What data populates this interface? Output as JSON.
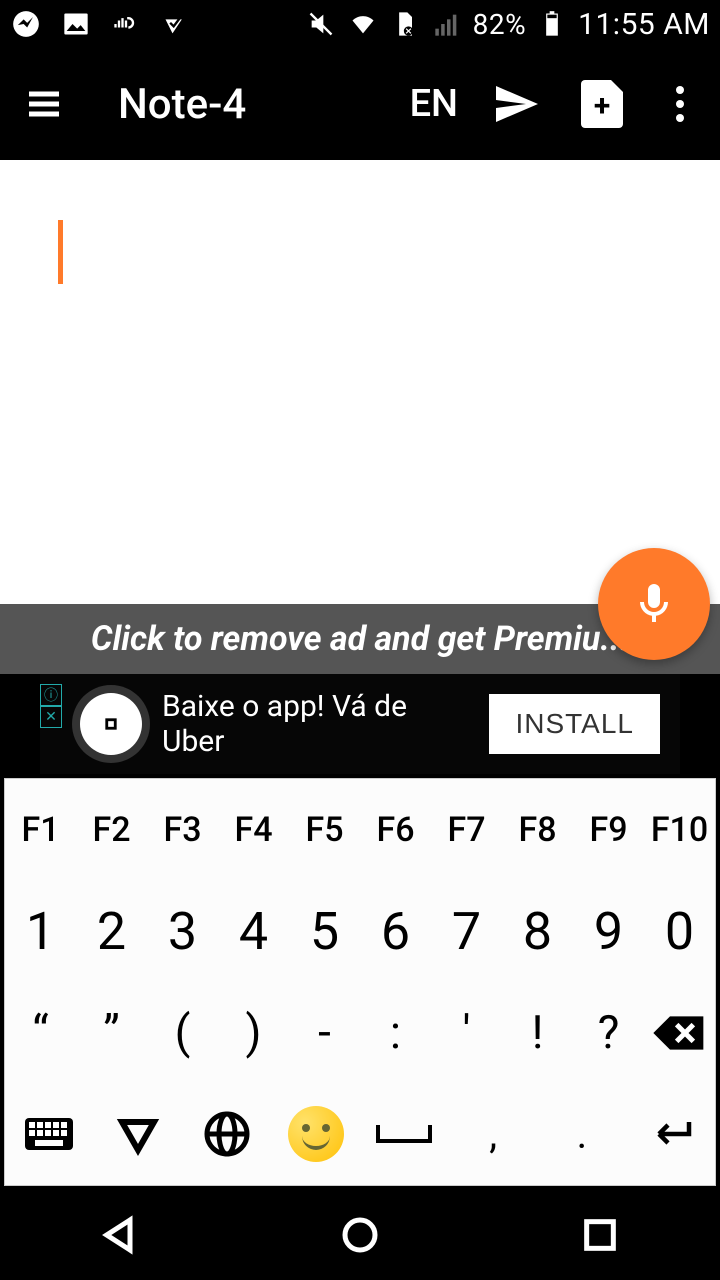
{
  "status": {
    "battery": "82%",
    "time": "11:55 AM"
  },
  "appbar": {
    "title": "Note-4",
    "lang": "EN"
  },
  "premium_text": "Click to remove ad and get Premiu...",
  "ad": {
    "text": "Baixe o app! Vá de Uber",
    "install_label": "INSTALL"
  },
  "kb": {
    "fn": [
      "F1",
      "F2",
      "F3",
      "F4",
      "F5",
      "F6",
      "F7",
      "F8",
      "F9",
      "F10"
    ],
    "num": [
      "1",
      "2",
      "3",
      "4",
      "5",
      "6",
      "7",
      "8",
      "9",
      "0"
    ],
    "sym": [
      "“",
      "”",
      "(",
      ")",
      "-",
      ":",
      "'",
      "!",
      "?"
    ],
    "comma": ",",
    "period": "."
  }
}
